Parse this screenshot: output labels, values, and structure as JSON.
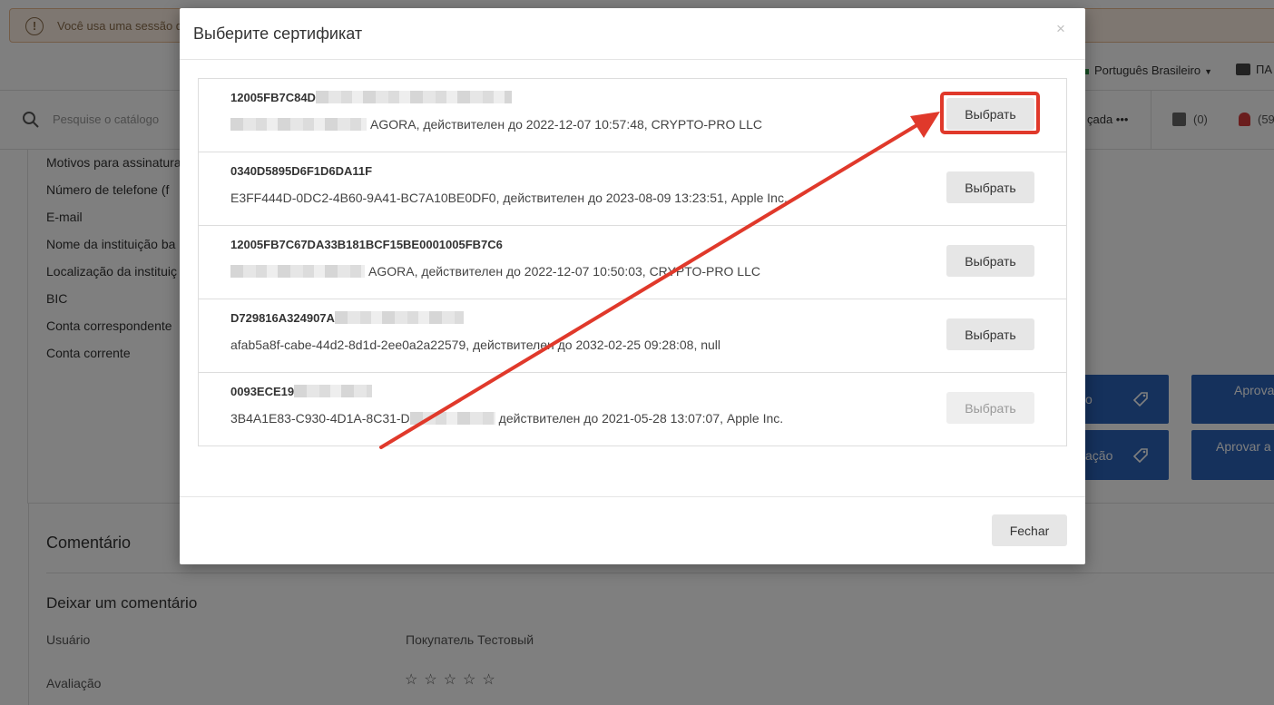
{
  "background": {
    "notice_text": "Você usa uma sessão d",
    "language": "Português Brasileiro",
    "briefcase_label": "ПА",
    "search_placeholder": "Pesquise o catálogo",
    "actions_label": "çada •••",
    "compare_count": "(0)",
    "notifications_count": "(59",
    "fields": [
      "Motivos para assinatura",
      "Número de telefone (f",
      "E-mail",
      "Nome da instituição ba",
      "Localização da instituiç",
      "BIC",
      "Conta correspondente",
      "Conta corrente"
    ],
    "buttons": {
      "b1": "o",
      "b2": "Aprova",
      "b3": "ação",
      "b4": "Aprovar a"
    },
    "comment_title": "Comentário",
    "leave_comment_title": "Deixar um comentário",
    "user_label": "Usuário",
    "user_value": "Покупатель Тестовый",
    "rating_label": "Avaliação",
    "rating_stars": "☆☆☆☆☆"
  },
  "modal": {
    "title": "Выберите сертификат",
    "close_symbol": "×",
    "choose_label": "Выбрать",
    "footer_close": "Fechar",
    "certificates": [
      {
        "id": "12005FB7C84D",
        "desc": "AGORA, действителен до 2022-12-07 10:57:48, CRYPTO-PRO LLC",
        "enabled": true
      },
      {
        "id": "0340D5895D6F1D6DA11F",
        "desc": "E3FF444D-0DC2-4B60-9A41-BC7A10BE0DF0, действителен до 2023-08-09 13:23:51, Apple Inc.",
        "enabled": true
      },
      {
        "id": "12005FB7C67DA33B181BCF15BE0001005FB7C6",
        "desc": "AGORA, действителен до 2022-12-07 10:50:03, CRYPTO-PRO LLC",
        "enabled": true
      },
      {
        "id": "D729816A324907A",
        "desc": "afab5a8f-cabe-44d2-8d1d-2ee0a2a22579, действителен до 2032-02-25 09:28:08, null",
        "enabled": true
      },
      {
        "id": "0093ECE19",
        "desc_prefix": "3B4A1E83-C930-4D1A-8C31-D",
        "desc": "действителен до 2021-05-28 13:07:07, Apple Inc.",
        "enabled": false
      }
    ]
  },
  "annotation": {
    "color": "#e0392b"
  }
}
